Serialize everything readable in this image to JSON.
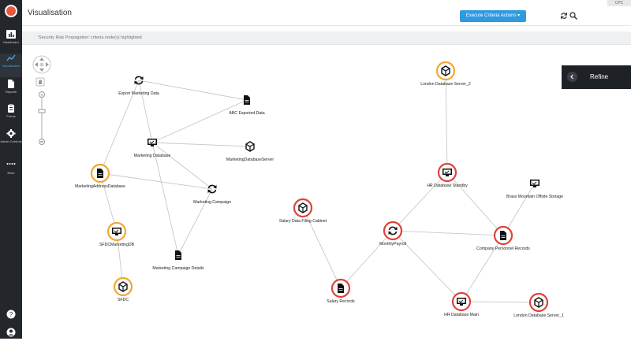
{
  "app": {
    "title": "Visualisation",
    "badge": "CPC"
  },
  "sidebar": {
    "items": [
      {
        "label": "Dashboard",
        "icon": "bar-chart-icon"
      },
      {
        "label": "Visualisation",
        "icon": "trend-line-icon"
      },
      {
        "label": "Reports",
        "icon": "document-icon"
      },
      {
        "label": "Forms",
        "icon": "clipboard-icon"
      },
      {
        "label": "Admin Controls",
        "icon": "gear-icon"
      },
      {
        "label": "More",
        "icon": "more-dots-icon"
      }
    ]
  },
  "toolbar": {
    "execute_label": "Execute Criteria Actions ▾"
  },
  "banner": {
    "text": "'Security Risk Propagation' criteria node(s) highlighted"
  },
  "refine": {
    "label": "Refine"
  },
  "graph": {
    "nodes": [
      {
        "id": "export",
        "label": "Export Marketing Data",
        "icon": "sync",
        "ring": "none"
      },
      {
        "id": "abc",
        "label": "ABC Exported Data",
        "icon": "file",
        "ring": "none"
      },
      {
        "id": "mktdb",
        "label": "Marketing Database",
        "icon": "monitor",
        "ring": "none"
      },
      {
        "id": "mktsrv",
        "label": "MarketingDatabaseServer",
        "icon": "cube",
        "ring": "none"
      },
      {
        "id": "mktaddr",
        "label": "MarketingAddressDatabase",
        "icon": "file",
        "ring": "orange"
      },
      {
        "id": "mktcamp",
        "label": "Marketing Campaign",
        "icon": "sync",
        "ring": "none"
      },
      {
        "id": "sfdcdb",
        "label": "SFDCMarketingDB",
        "icon": "monitor",
        "ring": "orange"
      },
      {
        "id": "mktcampdet",
        "label": "Marketing Campaign Details",
        "icon": "file",
        "ring": "none"
      },
      {
        "id": "sfdc",
        "label": "SFDC",
        "icon": "cube",
        "ring": "orange"
      },
      {
        "id": "london2",
        "label": "London Database Server_2",
        "icon": "cube",
        "ring": "orange"
      },
      {
        "id": "hrstandby",
        "label": "HR Database Standby",
        "icon": "monitor",
        "ring": "red"
      },
      {
        "id": "brass",
        "label": "Brass Mountain Offsite Storage",
        "icon": "monitor",
        "ring": "none"
      },
      {
        "id": "salcab",
        "label": "Salary Data Filing Cabinet",
        "icon": "cube",
        "ring": "red"
      },
      {
        "id": "payroll",
        "label": "MonthlyPayroll",
        "icon": "sync",
        "ring": "red"
      },
      {
        "id": "personnel",
        "label": "Company Personnel Records",
        "icon": "file",
        "ring": "red"
      },
      {
        "id": "salrec",
        "label": "Salary Records",
        "icon": "file",
        "ring": "red"
      },
      {
        "id": "hrmain",
        "label": "HR Database Main",
        "icon": "monitor",
        "ring": "red"
      },
      {
        "id": "london1",
        "label": "London Database Server_1",
        "icon": "cube",
        "ring": "red"
      }
    ],
    "edges": [
      [
        "export",
        "abc"
      ],
      [
        "export",
        "mktdb"
      ],
      [
        "export",
        "mktaddr"
      ],
      [
        "mktdb",
        "abc"
      ],
      [
        "mktdb",
        "mktsrv"
      ],
      [
        "mktdb",
        "mktcamp"
      ],
      [
        "mktdb",
        "mktcampdet"
      ],
      [
        "mktaddr",
        "mktcamp"
      ],
      [
        "mktaddr",
        "sfdcdb"
      ],
      [
        "mktcamp",
        "mktcampdet"
      ],
      [
        "sfdcdb",
        "sfdc"
      ],
      [
        "london2",
        "hrstandby"
      ],
      [
        "hrstandby",
        "payroll"
      ],
      [
        "hrstandby",
        "personnel"
      ],
      [
        "brass",
        "personnel"
      ],
      [
        "salcab",
        "salrec"
      ],
      [
        "payroll",
        "salrec"
      ],
      [
        "payroll",
        "personnel"
      ],
      [
        "payroll",
        "hrmain"
      ],
      [
        "personnel",
        "hrmain"
      ],
      [
        "hrmain",
        "london1"
      ]
    ],
    "colors": {
      "orange": "#f0a830",
      "red": "#e0413a",
      "edge": "#c8c8c8"
    }
  }
}
